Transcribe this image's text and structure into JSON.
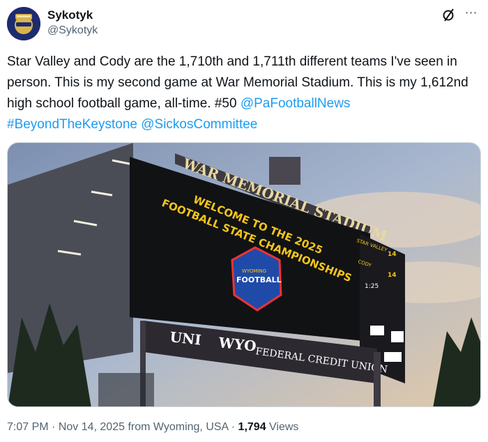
{
  "author": {
    "name": "Sykotyk",
    "handle": "@Sykotyk"
  },
  "tweet": {
    "text_parts": [
      "Star Valley and Cody are the 1,710th and 1,711th different teams I've seen in person. This is my second game at War Memorial Stadium. This is my 1,612nd high school football game, all-time. #50 "
    ],
    "mentions": {
      "pafootballnews": "@PaFootballNews",
      "hashtag": "#BeyondTheKeystone",
      "sickos": "@SickosCommittee"
    }
  },
  "image": {
    "stadium_sign": "WAR MEMORIAL STADIUM",
    "board_line1": "WELCOME TO THE 2025",
    "board_line2": "FOOTBALL STATE CHAMPIONSHIPS",
    "logo_text": "FOOTBALL",
    "logo_sub": "WYOMING",
    "score_team1": "STAR VALLEY",
    "score_team1_pts": "14",
    "score_team2": "CODY",
    "score_team2_pts": "14",
    "clock": "1:25",
    "sponsor_left": "UNI",
    "sponsor_right": "WYO",
    "sponsor_tail": "FEDERAL CREDIT UNION"
  },
  "meta": {
    "time": "7:07 PM",
    "dot1": " · ",
    "date": "Nov 14, 2025 from Wyoming, USA",
    "dot2": " · ",
    "views": "1,794",
    "views_label": " Views"
  },
  "colors": {
    "link": "#1d9bf0",
    "secondary_text": "#536471",
    "board_text": "#f5c518"
  }
}
